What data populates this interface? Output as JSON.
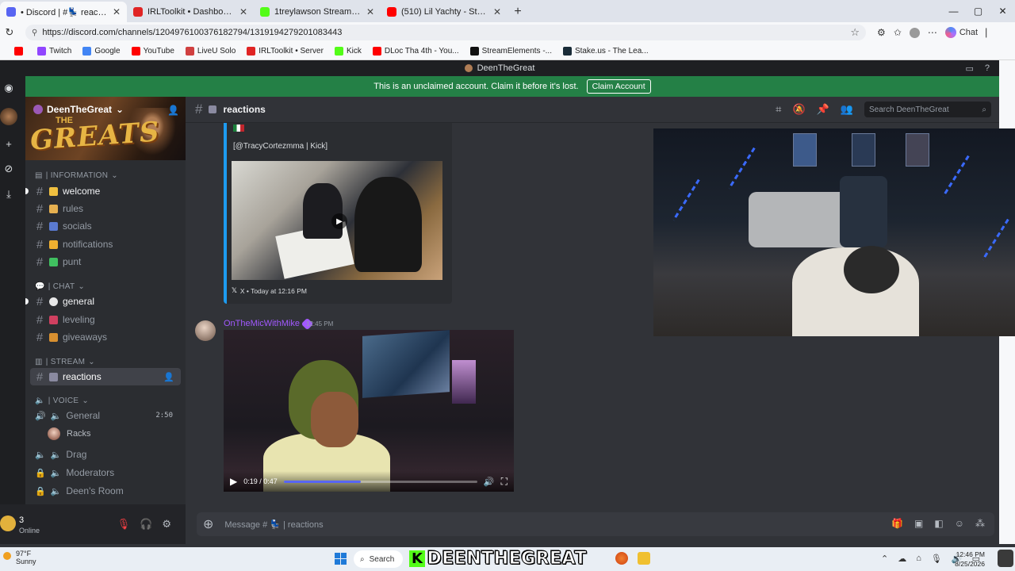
{
  "browser": {
    "tabs": [
      {
        "label": "• Discord | #💺 reactions | Deen",
        "icon_color": "#5865f2",
        "active": true
      },
      {
        "label": "IRLToolkit • Dashboard",
        "icon_color": "#e02424",
        "active": false
      },
      {
        "label": "1treylawson Stream - Watch Live o",
        "icon_color": "#53fc18",
        "active": false
      },
      {
        "label": "(510) Lil Yachty - Strike (Holster) (O",
        "icon_color": "#ff0000",
        "active": false
      }
    ],
    "url": "https://discord.com/channels/1204976100376182794/1319194279201083443",
    "chat_label": "Chat",
    "bookmarks": [
      {
        "label": "",
        "color": "#ff0000"
      },
      {
        "label": "Twitch",
        "color": "#9146ff"
      },
      {
        "label": "Google",
        "color": "#4285f4"
      },
      {
        "label": "YouTube",
        "color": "#ff0000"
      },
      {
        "label": "LiveU Solo",
        "color": "#d04040"
      },
      {
        "label": "IRLToolkit • Server",
        "color": "#e02424"
      },
      {
        "label": "Kick",
        "color": "#53fc18"
      },
      {
        "label": "DLoc Tha 4th - You...",
        "color": "#ff0000"
      },
      {
        "label": "StreamElements -...",
        "color": "#111111"
      },
      {
        "label": "Stake.us - The Lea...",
        "color": "#1a2c38"
      }
    ]
  },
  "discord": {
    "window_title": "DeenTheGreat",
    "banner_text": "This is an unclaimed account. Claim it before it's lost.",
    "claim_label": "Claim Account",
    "server_name": "DeenTheGreat",
    "server_banner_small": "THE",
    "server_banner_big": "GREATS",
    "categories": {
      "information": "| INFORMATION",
      "chat": "| CHAT",
      "stream": "| STREAM",
      "voice": "| VOICE"
    },
    "channels": {
      "welcome": "welcome",
      "rules": "rules",
      "socials": "socials",
      "notifications": "notifications",
      "punt": "punt",
      "general": "general",
      "leveling": "leveling",
      "giveaways": "giveaways",
      "reactions": "reactions",
      "voice_general": "General",
      "voice_general_timer": "2:50",
      "voice_member": "Racks",
      "drag": "Drag",
      "moderators": "Moderators",
      "deens_room": "Deen's Room"
    },
    "user": {
      "name": "3",
      "status": "Online"
    },
    "channel_header": "reactions",
    "search_placeholder": "Search DeenTheGreat",
    "embed": {
      "handle": "[@TracyCortezmma | Kick]",
      "footer": "X • Today at 12:16 PM"
    },
    "message": {
      "author": "OnTheMicWithMike",
      "time": "12:45 PM",
      "video_time": "0:19 / 0:47",
      "progress": 0.4
    },
    "composer_placeholder": "Message # 💺 | reactions"
  },
  "taskbar": {
    "temp": "97°F",
    "condition": "Sunny",
    "search": "Search",
    "overlay_text": "DEENTHEGREAT",
    "time": "12:46 PM",
    "date": "8/25/2026"
  }
}
